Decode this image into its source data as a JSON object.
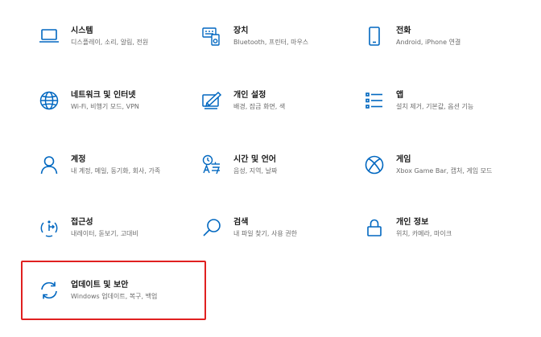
{
  "accent_color": "#0067c0",
  "highlight_color": "#e02020",
  "tiles": [
    {
      "icon": "laptop-icon",
      "title": "시스템",
      "desc": "디스플레이, 소리, 알림, 전원"
    },
    {
      "icon": "devices-icon",
      "title": "장치",
      "desc": "Bluetooth, 프린터, 마우스"
    },
    {
      "icon": "phone-icon",
      "title": "전화",
      "desc": "Android, iPhone 연결"
    },
    {
      "icon": "globe-icon",
      "title": "네트워크 및 인터넷",
      "desc": "Wi-Fi, 비행기 모드, VPN"
    },
    {
      "icon": "personalization-icon",
      "title": "개인 설정",
      "desc": "배경, 잠금 화면, 색"
    },
    {
      "icon": "apps-list-icon",
      "title": "앱",
      "desc": "설치 제거, 기본값, 옵션 기능"
    },
    {
      "icon": "person-icon",
      "title": "계정",
      "desc": "내 계정, 메일, 동기화, 회사, 가족"
    },
    {
      "icon": "language-icon",
      "title": "시간 및 언어",
      "desc": "음성, 지역, 날짜"
    },
    {
      "icon": "xbox-icon",
      "title": "게임",
      "desc": "Xbox Game Bar, 캡처, 게임 모드"
    },
    {
      "icon": "accessibility-icon",
      "title": "접근성",
      "desc": "내레이터, 돋보기, 고대비"
    },
    {
      "icon": "search-icon",
      "title": "검색",
      "desc": "내 파일 찾기, 사용 권한"
    },
    {
      "icon": "lock-icon",
      "title": "개인 정보",
      "desc": "위치, 카메라, 마이크"
    },
    {
      "icon": "sync-icon",
      "title": "업데이트 및 보안",
      "desc": "Windows 업데이트, 복구, 백업"
    }
  ]
}
